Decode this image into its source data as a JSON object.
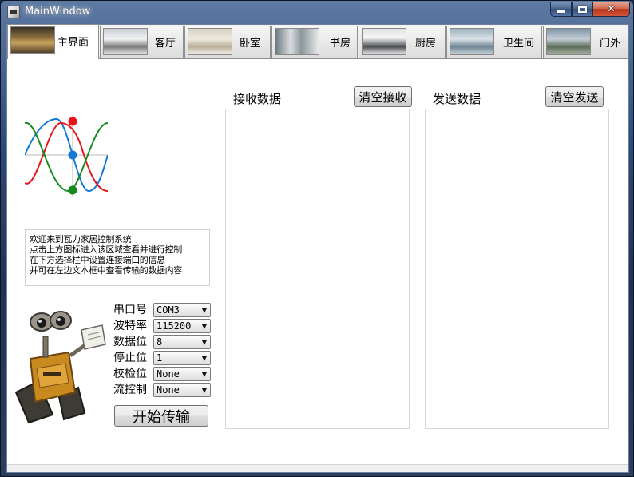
{
  "window": {
    "title": "MainWindow"
  },
  "tabs": [
    {
      "label": "主界面",
      "active": true
    },
    {
      "label": "客厅",
      "active": false
    },
    {
      "label": "卧室",
      "active": false
    },
    {
      "label": "书房",
      "active": false
    },
    {
      "label": "厨房",
      "active": false
    },
    {
      "label": "卫生间",
      "active": false
    },
    {
      "label": "门外",
      "active": false
    }
  ],
  "info": {
    "lines": [
      "欢迎来到瓦力家居控制系统",
      "点击上方图标进入该区域查看并进行控制",
      "在下方选择栏中设置连接端口的信息",
      "并可在左边文本框中查看传输的数据内容"
    ]
  },
  "serial": {
    "fields": [
      {
        "label": "串口号",
        "value": "COM3"
      },
      {
        "label": "波特率",
        "value": "115200"
      },
      {
        "label": "数据位",
        "value": "8"
      },
      {
        "label": "停止位",
        "value": "1"
      },
      {
        "label": "校检位",
        "value": "None"
      },
      {
        "label": "流控制",
        "value": "None"
      }
    ],
    "start_label": "开始传输"
  },
  "receive": {
    "title": "接收数据",
    "clear_label": "清空接收",
    "content": ""
  },
  "send": {
    "title": "发送数据",
    "clear_label": "清空发送",
    "content": ""
  },
  "icons": {
    "window": "app-icon",
    "wave": "sine-wave-icon",
    "robot": "walle-robot-image"
  },
  "colors": {
    "wave_red": "#e8141a",
    "wave_blue": "#1478d6",
    "wave_green": "#168a1c"
  }
}
